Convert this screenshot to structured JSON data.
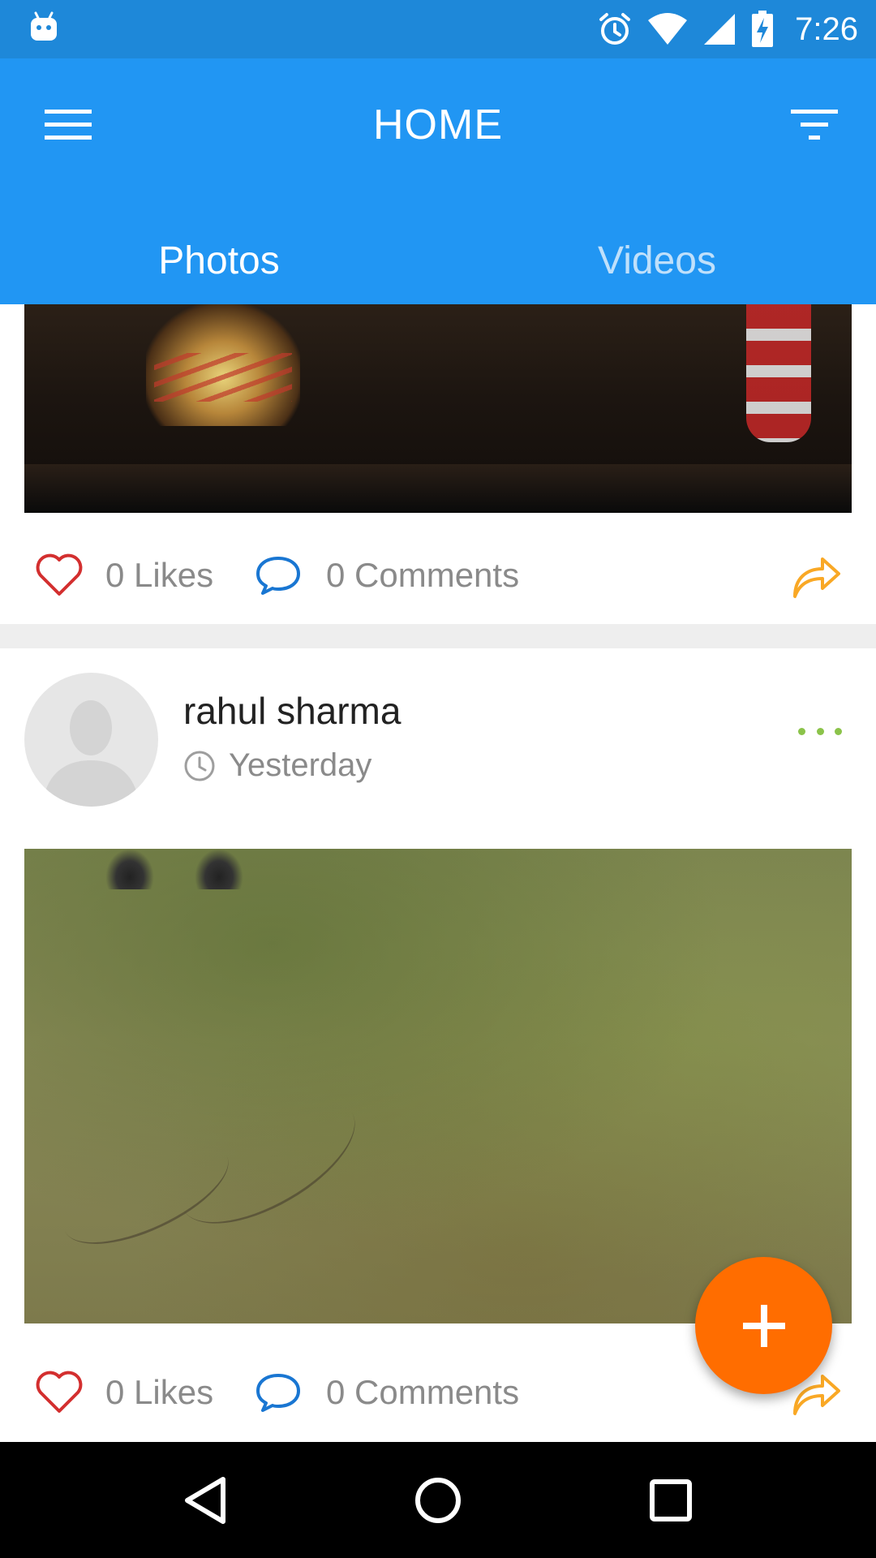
{
  "status_bar": {
    "time": "7:26",
    "icons": [
      "android-icon",
      "alarm-icon",
      "wifi-icon",
      "signal-icon",
      "battery-charging-icon"
    ]
  },
  "app_bar": {
    "title": "HOME",
    "menu_icon": "hamburger-menu-icon",
    "filter_icon": "filter-icon",
    "background": "#2196f3"
  },
  "tabs": [
    {
      "label": "Photos",
      "active": true
    },
    {
      "label": "Videos",
      "active": false
    }
  ],
  "feed": {
    "posts": [
      {
        "likes": "0 Likes",
        "comments": "0 Comments"
      },
      {
        "author": "rahul sharma",
        "time": "Yesterday",
        "likes": "0 Likes",
        "comments": "0 Comments"
      }
    ]
  },
  "fab": {
    "icon": "plus-icon",
    "color": "#ff6d00"
  },
  "colors": {
    "like": "#d32f2f",
    "comment": "#1976d2",
    "share": "#f9a825",
    "more": "#8bc34a"
  },
  "nav_bar": {
    "buttons": [
      "back-icon",
      "home-icon",
      "recents-icon"
    ]
  }
}
